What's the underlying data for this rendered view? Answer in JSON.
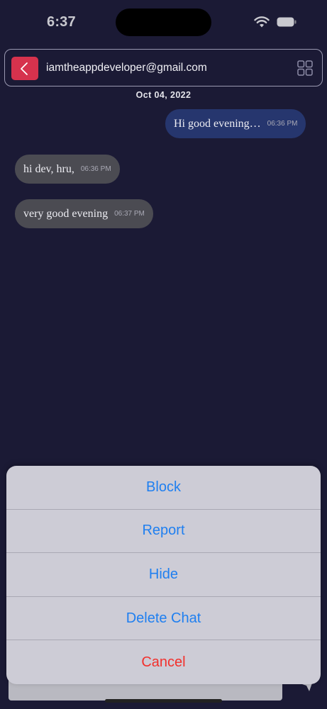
{
  "status_bar": {
    "time": "6:37"
  },
  "header": {
    "email": "iamtheappdeveloper@gmail.com"
  },
  "date_label": "Oct 04, 2022",
  "messages": [
    {
      "direction": "outgoing",
      "text": "Hi good evening…",
      "time": "06:36 PM"
    },
    {
      "direction": "incoming",
      "text": "hi dev, hru,",
      "time": "06:36 PM"
    },
    {
      "direction": "incoming",
      "text": "very good evening",
      "time": "06:37 PM"
    }
  ],
  "action_sheet": {
    "items": [
      {
        "label": "Block"
      },
      {
        "label": "Report"
      },
      {
        "label": "Hide"
      },
      {
        "label": "Delete Chat"
      },
      {
        "label": "Cancel"
      }
    ]
  },
  "colors": {
    "background": "#1b1a35",
    "accent_back": "#d6324d",
    "action_blue": "#1f7ff0",
    "destructive_red": "#f2302c",
    "outgoing_bubble": "#26366e",
    "incoming_bubble": "#4b4b52"
  },
  "icons": {
    "back": "chevron-left-icon",
    "menu": "grid-icon",
    "send": "send-icon",
    "wifi": "wifi-icon",
    "battery": "battery-icon"
  }
}
